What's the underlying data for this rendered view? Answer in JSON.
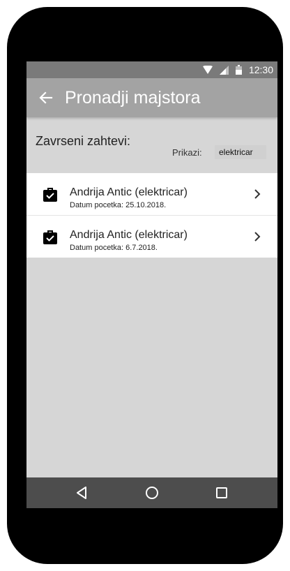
{
  "status_bar": {
    "time": "12:30"
  },
  "app_bar": {
    "title": "Pronadji majstora"
  },
  "section": {
    "title": "Zavrseni zahtevi:",
    "filter_label": "Prikazi:",
    "filter_value": "elektricar"
  },
  "requests": [
    {
      "title": "Andrija Antic (elektricar)",
      "subtitle": "Datum pocetka: 25.10.2018."
    },
    {
      "title": "Andrija Antic (elektricar)",
      "subtitle": "Datum pocetka: 6.7.2018."
    }
  ],
  "icons": {
    "back": "arrow-left-icon",
    "item": "briefcase-check-icon",
    "chevron": "chevron-right-icon",
    "nav_back": "triangle-back-icon",
    "nav_home": "circle-home-icon",
    "nav_recent": "square-recents-icon"
  },
  "colors": {
    "status_bar": "#7a7a7a",
    "app_bar": "#a3a3a3",
    "background": "#d6d6d6",
    "nav_bar": "#4d4d4d"
  }
}
